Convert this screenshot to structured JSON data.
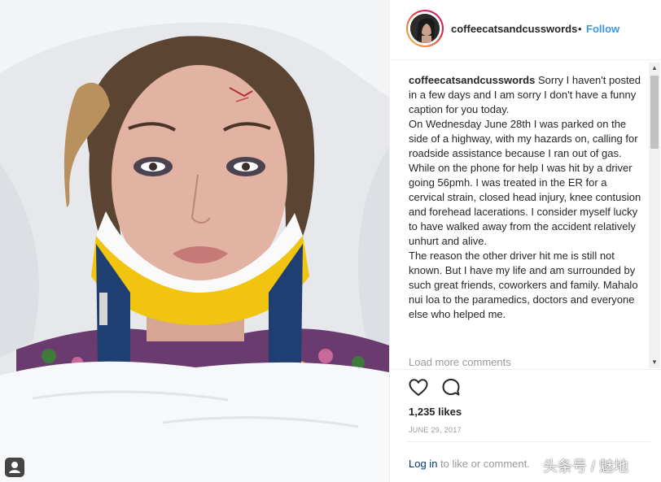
{
  "post": {
    "username": "coffeecatsandcusswords",
    "separator": "•",
    "follow_label": "Follow",
    "caption": {
      "username": "coffeecatsandcusswords",
      "paragraphs": [
        "Sorry I haven't posted in a few days and I am sorry I don't have a funny caption for you today.",
        "On Wednesday June 28th I was parked on the side of a highway, with my hazards on, calling for roadside assistance because I ran out of gas. While on the phone for help I was hit by a driver going 56pmh. I was treated in the ER for a cervical strain, closed head injury, knee contusion and forehead lacerations. I consider myself lucky to have walked away from the accident relatively unhurt and alive.",
        "The reason the other driver hit me is still not known. But I have my life and am surrounded by such great friends, coworkers and family. Mahalo nui loa to the paramedics, doctors and everyone else who helped me."
      ]
    },
    "load_more_label": "Load more comments",
    "likes": "1,235 likes",
    "date": "JUNE 29, 2017",
    "login_link": "Log in",
    "login_text": " to like or comment.",
    "icons": {
      "like": "heart-icon",
      "comment": "comment-bubble-icon",
      "user_tag": "user-tag-icon",
      "scroll_up": "scroll-up-arrow-icon",
      "scroll_down": "scroll-down-arrow-icon"
    },
    "colors": {
      "follow": "#3897f0",
      "text": "#262626",
      "muted": "#999999",
      "link": "#003569"
    }
  },
  "watermark": "头条号 / 魅地"
}
